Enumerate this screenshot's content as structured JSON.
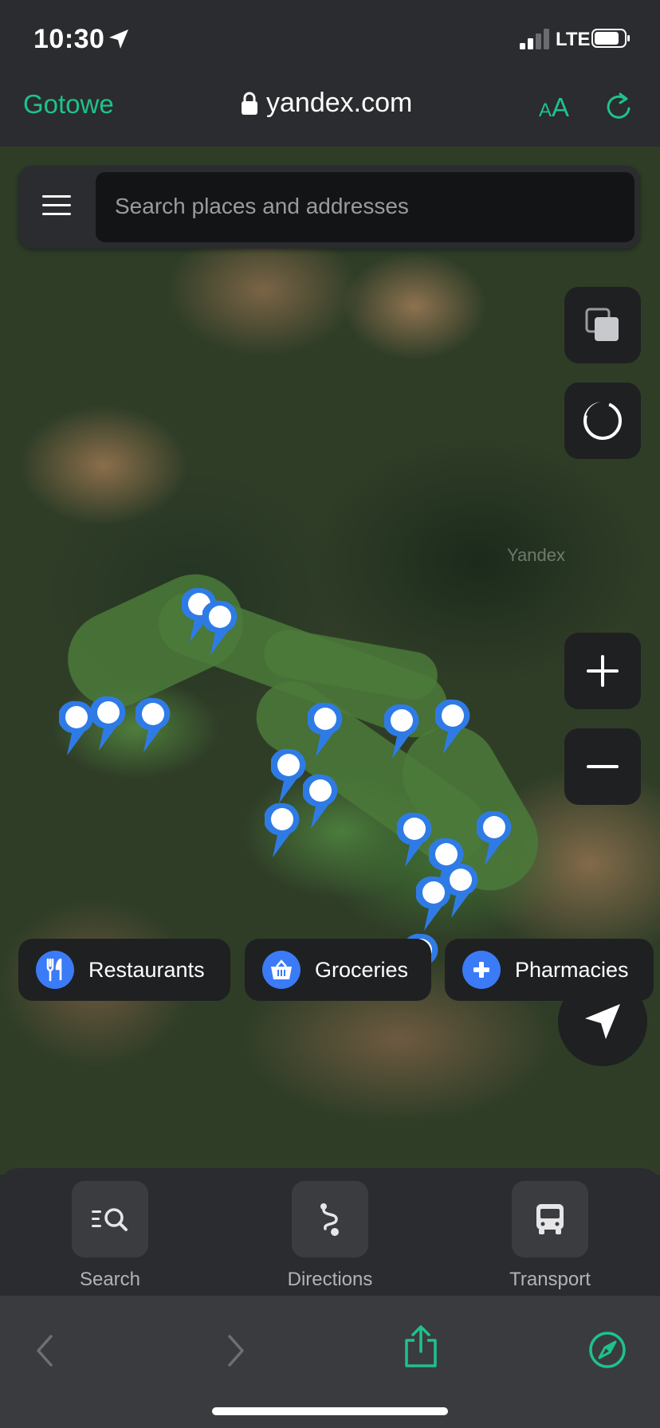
{
  "status": {
    "time": "10:30",
    "network": "LTE"
  },
  "browser": {
    "done_label": "Gotowe",
    "url": "yandex.com",
    "text_size_small": "A",
    "text_size_big": "A"
  },
  "map": {
    "watermark": "Yandex",
    "search_placeholder": "Search places and addresses"
  },
  "chips": [
    {
      "label": "Restaurants",
      "icon": "fork-knife-icon"
    },
    {
      "label": "Groceries",
      "icon": "basket-icon"
    },
    {
      "label": "Pharmacies",
      "icon": "plus-icon"
    }
  ],
  "tabs": [
    {
      "label": "Search",
      "icon": "search-list-icon"
    },
    {
      "label": "Directions",
      "icon": "route-icon"
    },
    {
      "label": "Transport",
      "icon": "bus-icon"
    }
  ],
  "colors": {
    "accent": "#1ec28b",
    "pin": "#2f7be6",
    "chip_icon_bg": "#3b7bf7",
    "panel_bg": "#2b2c2f"
  }
}
